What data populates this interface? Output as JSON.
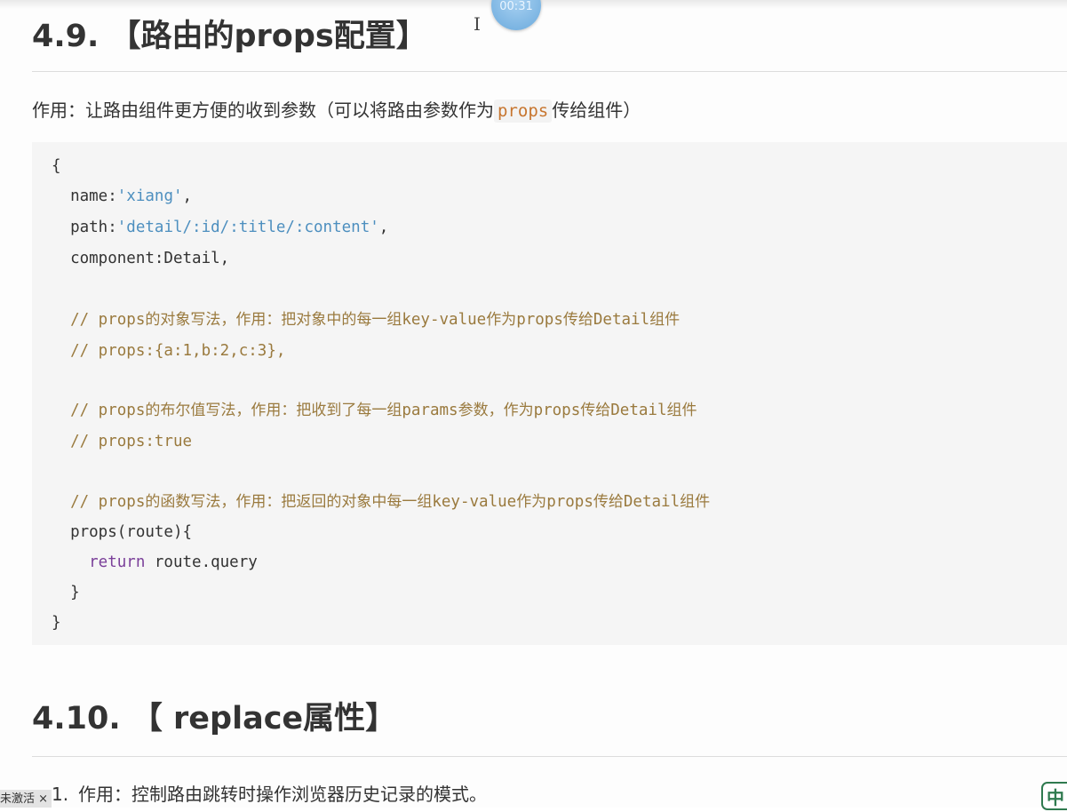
{
  "section_props": {
    "heading": "4.9. 【路由的props配置】",
    "description_prefix": "作用：让路由组件更方便的收到参数（可以将路由参数作为",
    "description_code": "props",
    "description_suffix": "传给组件）"
  },
  "code": {
    "l01": "{",
    "l02_key": "  name:",
    "l02_val": "'xiang'",
    "l02_end": ",",
    "l03_key": "  path:",
    "l03_val": "'detail/:id/:title/:content'",
    "l03_end": ",",
    "l04": "  component:Detail,",
    "l05_a": "  // props",
    "l05_b": "的对象写法，作用：把对象中的每一组",
    "l05_c": "key-value",
    "l05_d": "作为",
    "l05_e": "props",
    "l05_f": "传给",
    "l05_g": "Detail",
    "l05_h": "组件",
    "l06": "  // props:{a:1,b:2,c:3},",
    "l07_a": "  // props",
    "l07_b": "的布尔值写法，作用：把收到了每一组",
    "l07_c": "params",
    "l07_d": "参数，作为",
    "l07_e": "props",
    "l07_f": "传给",
    "l07_g": "Detail",
    "l07_h": "组件",
    "l08": "  // props:true",
    "l09_a": "  // props",
    "l09_b": "的函数写法，作用：把返回的对象中每一组",
    "l09_c": "key-value",
    "l09_d": "作为",
    "l09_e": "props",
    "l09_f": "传给",
    "l09_g": "Detail",
    "l09_h": "组件",
    "l10": "  props(route){",
    "l11_kw": "    return",
    "l11_rest": " route.query",
    "l12": "  }",
    "l13": "}"
  },
  "section_replace": {
    "heading": "4.10. 【 replace属性】",
    "list_number": "1.",
    "list_text": "作用：控制路由跳转时操作浏览器历史记录的模式。"
  },
  "overlay": {
    "timer": "00:31",
    "cursor_glyph": "I",
    "activate_tag": "未激活 ×",
    "ime_label": "中"
  }
}
